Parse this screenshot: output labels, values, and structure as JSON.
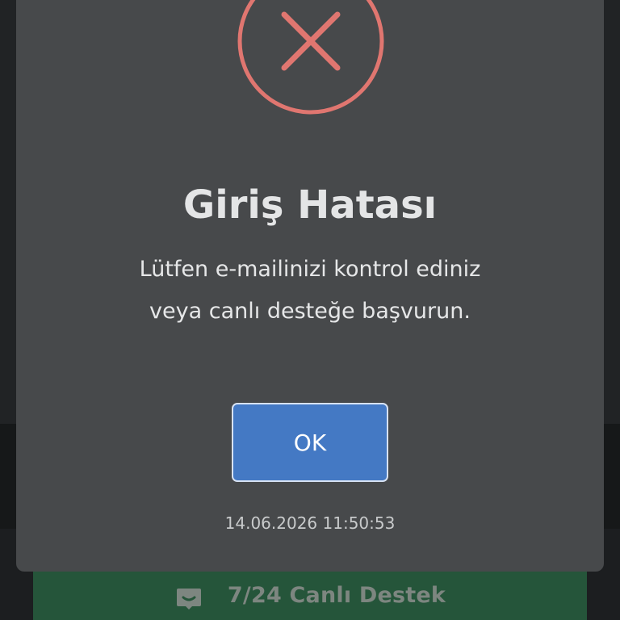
{
  "dialog": {
    "icon": "error-x-icon",
    "icon_color": "#e07670",
    "title": "Giriş Hatası",
    "message": "Lütfen e-mailinizi kontrol ediniz veya canlı desteğe başvurun.",
    "ok_label": "OK",
    "timestamp": "14.06.2026 11:50:53",
    "button_color": "#4479c4"
  },
  "support": {
    "icon": "chat-bubble-icon",
    "label": "7/24 Canlı Destek",
    "color": "#25553a"
  }
}
